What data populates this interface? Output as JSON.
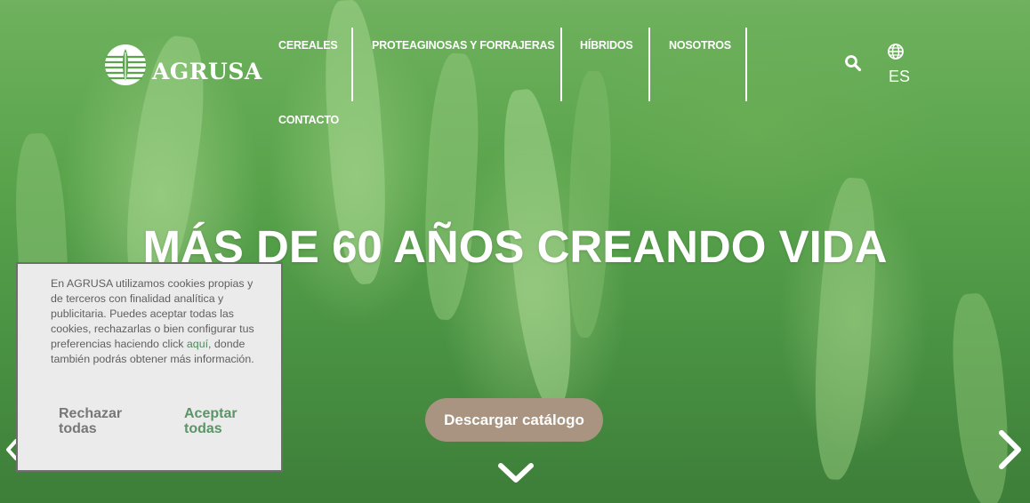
{
  "logo": {
    "text": "AGRUSA"
  },
  "nav": [
    {
      "label": "CEREALES"
    },
    {
      "label": "PROTEAGINOSAS Y FORRAJERAS"
    },
    {
      "label": "HÍBRIDOS"
    },
    {
      "label": "NOSOTROS"
    },
    {
      "label": "CONTACTO"
    }
  ],
  "header": {
    "search_icon": "search-icon",
    "lang_icon": "globe-icon",
    "lang": "ES"
  },
  "hero": {
    "headline": "MÁS DE 60 AÑOS CREANDO VIDA",
    "cta": "Descargar catálogo",
    "scroll_icon": "chevron-down-icon",
    "next_icon": "chevron-right-icon",
    "prev_icon": "chevron-left-icon"
  },
  "cookie": {
    "text_before": "En AGRUSA utilizamos cookies propias y de terceros con finalidad analítica y publicitaria. Puedes aceptar todas las cookies, rechazarlas o bien configurar tus preferencias haciendo click ",
    "link": "aquí",
    "text_after": ", donde también podrás obtener más información.",
    "reject": "Rechazar todas",
    "accept": "Aceptar todas",
    "accept_color": "#5b9467"
  },
  "colors": {
    "cta_bg": "#a89480",
    "field_green": "#5aa44c"
  }
}
